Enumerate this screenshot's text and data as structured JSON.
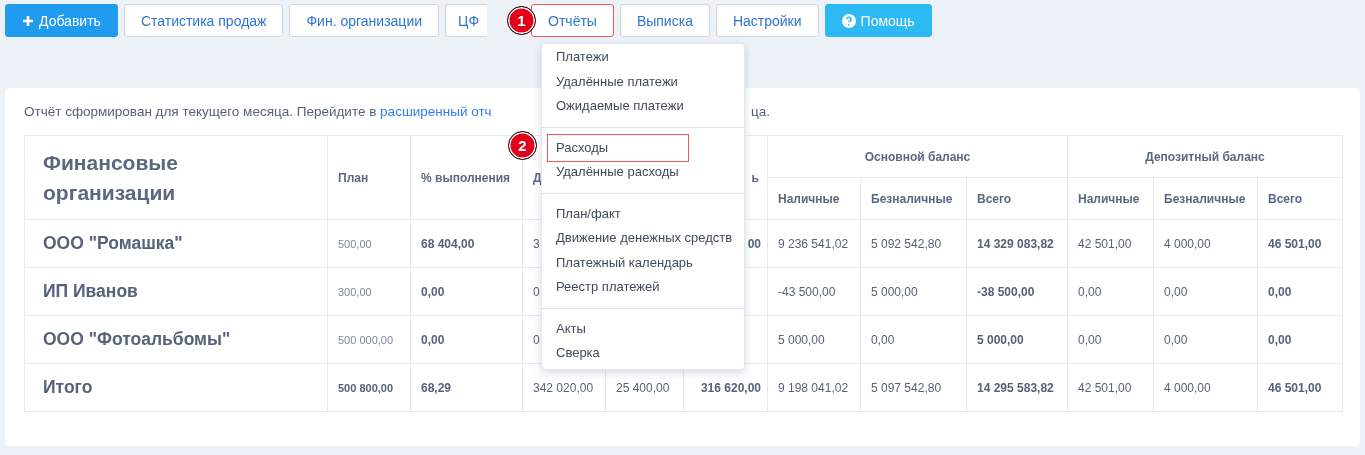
{
  "toolbar": {
    "buttons": [
      {
        "label": "Добавить",
        "kind": "primary",
        "selected": false
      },
      {
        "label": "Статистика продаж",
        "kind": "default",
        "selected": false
      },
      {
        "label": "Фин. организации",
        "kind": "default",
        "selected": false
      },
      {
        "label": "ЦФ",
        "kind": "default",
        "selected": false
      },
      {
        "label": "Отчёты",
        "kind": "default",
        "selected": true
      },
      {
        "label": "Выписка",
        "kind": "default",
        "selected": false
      },
      {
        "label": "Настройки",
        "kind": "default",
        "selected": false
      },
      {
        "label": "Помощь",
        "kind": "info",
        "selected": false
      }
    ]
  },
  "step_badges": [
    {
      "label": "1"
    },
    {
      "label": "2"
    }
  ],
  "dropdown": {
    "groups": [
      [
        {
          "label": "Платежи",
          "selected": false
        },
        {
          "label": "Удалённые платежи",
          "selected": false
        },
        {
          "label": "Ожидаемые платежи",
          "selected": false
        }
      ],
      [
        {
          "label": "Расходы",
          "selected": true
        },
        {
          "label": "Удалённые расходы",
          "selected": false
        }
      ],
      [
        {
          "label": "План/факт",
          "selected": false
        },
        {
          "label": "Движение денежных средств",
          "selected": false
        },
        {
          "label": "Платежный календарь",
          "selected": false
        },
        {
          "label": "Реестр платежей",
          "selected": false
        }
      ],
      [
        {
          "label": "Акты",
          "selected": false
        },
        {
          "label": "Сверка",
          "selected": false
        }
      ]
    ]
  },
  "note": {
    "before": "Отчёт сформирован для текущего месяца. Перейдите в",
    "link": "расширенный отч",
    "after": "ца."
  },
  "table": {
    "columns": {
      "name": "Финансовые организации",
      "plan": "План",
      "completion": "% выполнения",
      "column_4": "Д",
      "column_6": "ь"
    },
    "groups": [
      {
        "label": "Основной баланс",
        "columns": [
          "Наличные",
          "Безналичные",
          "Всего"
        ]
      },
      {
        "label": "Депозитный баланс",
        "columns": [
          "Наличные",
          "Безналичные",
          "Всего"
        ]
      }
    ],
    "rows": [
      {
        "kind": "item",
        "name": "ООО \"Ромашка\"",
        "plan": "500,00",
        "completion": "68 404,00",
        "column_4": "3",
        "column_6": "00",
        "main_cash": "9 236 541,02",
        "main_noncash": "5 092 542,80",
        "main_total": "14 329 083,82",
        "deposit_cash": "42 501,00",
        "deposit_noncash": "4 000,00",
        "deposit_total": "46 501,00"
      },
      {
        "kind": "item",
        "name": "ИП Иванов",
        "plan": "300,00",
        "completion": "0,00",
        "column_4": "0",
        "main_cash": "-43 500,00",
        "main_noncash": "5 000,00",
        "main_total": "-38 500,00",
        "deposit_cash": "0,00",
        "deposit_noncash": "0,00",
        "deposit_total": "0,00"
      },
      {
        "kind": "item",
        "name": "ООО \"Фотоальбомы\"",
        "plan": "500 000,00",
        "completion": "0,00",
        "column_4": "0",
        "main_cash": "5 000,00",
        "main_noncash": "0,00",
        "main_total": "5 000,00",
        "deposit_cash": "0,00",
        "deposit_noncash": "0,00",
        "deposit_total": "0,00"
      },
      {
        "kind": "total",
        "name": "Итого",
        "plan": "500 800,00",
        "completion": "68,29",
        "column_4": "342 020,00",
        "column_5": "25 400,00",
        "column_6": "316 620,00",
        "main_cash": "9 198 041,02",
        "main_noncash": "5 097 542,80",
        "main_total": "14 295 583,82",
        "deposit_cash": "42 501,00",
        "deposit_noncash": "4 000,00",
        "deposit_total": "46 501,00"
      }
    ]
  }
}
